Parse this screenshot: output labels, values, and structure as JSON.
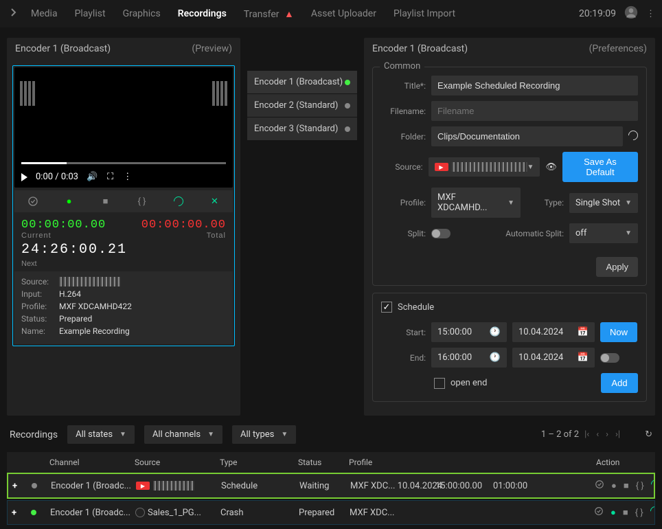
{
  "nav": {
    "tabs": [
      "Media",
      "Playlist",
      "Graphics",
      "Recordings",
      "Transfer",
      "Asset Uploader",
      "Playlist Import"
    ],
    "active": "Recordings",
    "alertTab": "Transfer",
    "clock": "20:19:09"
  },
  "preview": {
    "title": "Encoder 1 (Broadcast)",
    "sub": "(Preview)",
    "videoTime": "0:00 / 0:03",
    "tc": {
      "in": "00:00:00.00",
      "out": "00:00:00.00",
      "labelIn": "Current",
      "labelOut": "Total",
      "current": "24:26:00.21",
      "next": "Next"
    },
    "info": {
      "sourceLbl": "Source:",
      "sourceVal": "",
      "inputLbl": "Input:",
      "inputVal": "H.264",
      "profileLbl": "Profile:",
      "profileVal": "MXF XDCAMHD422",
      "statusLbl": "Status:",
      "statusVal": "Prepared",
      "nameLbl": "Name:",
      "nameVal": "Example Recording"
    }
  },
  "encoders": {
    "items": [
      {
        "name": "Encoder 1 (Broadcast)",
        "state": "green"
      },
      {
        "name": "Encoder 2 (Standard)",
        "state": "grey"
      },
      {
        "name": "Encoder 3 (Standard)",
        "state": "grey"
      }
    ]
  },
  "prefs": {
    "title": "Encoder 1 (Broadcast)",
    "sub": "(Preferences)",
    "common": {
      "legend": "Common",
      "titleLbl": "Title*:",
      "titleVal": "Example Scheduled Recording",
      "fileLbl": "Filename:",
      "filePh": "Filename",
      "folderLbl": "Folder:",
      "folderVal": "Clips/Documentation",
      "sourceLbl": "Source:",
      "sourceVal": "",
      "saveDefault": "Save As Default",
      "profileLbl": "Profile:",
      "profileVal": "MXF XDCAMHD...",
      "typeLbl": "Type:",
      "typeVal": "Single Shot",
      "splitLbl": "Split:",
      "autoSplitLbl": "Automatic Split:",
      "autoSplitVal": "off",
      "apply": "Apply"
    },
    "schedule": {
      "legend": "Schedule",
      "startLbl": "Start:",
      "startTime": "15:00:00",
      "startDate": "10.04.2024",
      "nowBtn": "Now",
      "endLbl": "End:",
      "endTime": "16:00:00",
      "endDate": "10.04.2024",
      "openEnd": "open end",
      "addBtn": "Add"
    }
  },
  "recordings": {
    "title": "Recordings",
    "filters": {
      "state": "All states",
      "channel": "All channels",
      "type": "All types"
    },
    "pager": "1 – 2 of 2",
    "cols": {
      "channel": "Channel",
      "source": "Source",
      "type": "Type",
      "status": "Status",
      "profile": "Profile",
      "action": "Action"
    },
    "rows": [
      {
        "dot": "grey",
        "channel": "Encoder 1 (Broadc...",
        "source": "",
        "type": "Schedule",
        "status": "Waiting",
        "profile": "MXF XDC...",
        "date": "10.04.2024",
        "start": "15:00:00.00",
        "dur": "01:00:00"
      },
      {
        "dot": "green",
        "channel": "Encoder 1 (Broadc...",
        "source": "Sales_1_PG...",
        "type": "Crash",
        "status": "Prepared",
        "profile": "MXF XDC...",
        "date": "",
        "start": "",
        "dur": ""
      }
    ]
  }
}
